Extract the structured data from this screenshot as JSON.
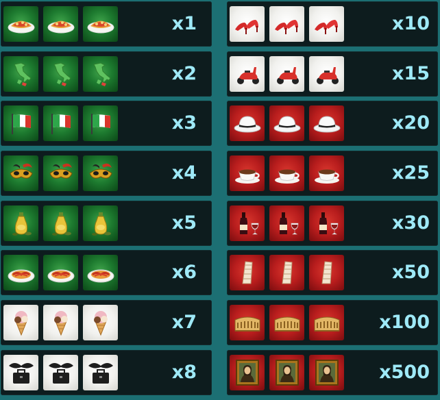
{
  "colors": {
    "background": "#1c6f73",
    "row_background": "#0d1c1e",
    "multiplier_text": "#9ee9f7"
  },
  "left_rows": [
    {
      "symbol": "pizza-icon",
      "tile": "green",
      "multiplier": "x1"
    },
    {
      "symbol": "italy-map-icon",
      "tile": "green",
      "multiplier": "x2"
    },
    {
      "symbol": "italian-flag-icon",
      "tile": "green",
      "multiplier": "x3"
    },
    {
      "symbol": "carnival-mask-icon",
      "tile": "green",
      "multiplier": "x4"
    },
    {
      "symbol": "olive-oil-icon",
      "tile": "green",
      "multiplier": "x5"
    },
    {
      "symbol": "spaghetti-icon",
      "tile": "green",
      "multiplier": "x6"
    },
    {
      "symbol": "gelato-cone-icon",
      "tile": "white",
      "multiplier": "x7"
    },
    {
      "symbol": "mustache-briefcase-icon",
      "tile": "white",
      "multiplier": "x8"
    }
  ],
  "right_rows": [
    {
      "symbol": "high-heels-icon",
      "tile": "white",
      "multiplier": "x10"
    },
    {
      "symbol": "scooter-icon",
      "tile": "white",
      "multiplier": "x15"
    },
    {
      "symbol": "fedora-hat-icon",
      "tile": "red",
      "multiplier": "x20"
    },
    {
      "symbol": "espresso-cup-icon",
      "tile": "red",
      "multiplier": "x25"
    },
    {
      "symbol": "wine-bottle-icon",
      "tile": "red",
      "multiplier": "x30"
    },
    {
      "symbol": "leaning-tower-icon",
      "tile": "red",
      "multiplier": "x50"
    },
    {
      "symbol": "colosseum-icon",
      "tile": "red",
      "multiplier": "x100"
    },
    {
      "symbol": "mona-lisa-icon",
      "tile": "red",
      "multiplier": "x500"
    }
  ]
}
